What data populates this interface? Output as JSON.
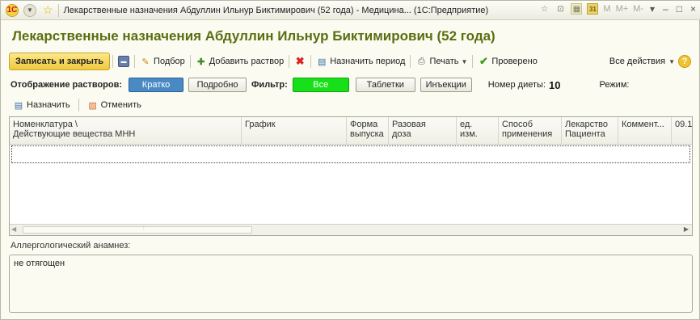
{
  "window": {
    "title": "Лекарственные назначения Абдуллин Ильнур Биктимирович (52 года) - Медицина... (1С:Предприятие)",
    "controls": {
      "m": "M",
      "m_plus": "M+",
      "m_minus": "M-",
      "minimize": "–",
      "maximize": "□",
      "close": "×"
    }
  },
  "header": {
    "title": "Лекарственные назначения Абдуллин Ильнур Биктимирович (52 года)"
  },
  "toolbar": {
    "save_close": "Записать и закрыть",
    "pick": "Подбор",
    "add_solution": "Добавить раствор",
    "assign_period": "Назначить период",
    "print": "Печать",
    "checked": "Проверено",
    "all_actions": "Все действия",
    "help": "?"
  },
  "display": {
    "label": "Отображение растворов:",
    "brief": "Кратко",
    "detailed": "Подробно",
    "filter_label": "Фильтр:",
    "filter_all": "Все",
    "tablets": "Таблетки",
    "injections": "Инъекции",
    "diet_label": "Номер диеты:",
    "diet_value": "10",
    "mode_label": "Режим:"
  },
  "actions": {
    "assign": "Назначить",
    "cancel": "Отменить"
  },
  "table": {
    "columns": [
      {
        "line1": "Номенклатура \\",
        "line2": "Действующие вещества МНН"
      },
      {
        "line1": "График",
        "line2": ""
      },
      {
        "line1": "Форма",
        "line2": "выпуска"
      },
      {
        "line1": "Разовая",
        "line2": "доза"
      },
      {
        "line1": "ед.",
        "line2": "изм."
      },
      {
        "line1": "Способ",
        "line2": "применения"
      },
      {
        "line1": "Лекарство",
        "line2": "Пациента"
      },
      {
        "line1": "Коммент...",
        "line2": ""
      },
      {
        "line1": "09.1",
        "line2": ""
      }
    ]
  },
  "allergy": {
    "label": "Аллергологический анамнез:",
    "value": "не отягощен"
  }
}
